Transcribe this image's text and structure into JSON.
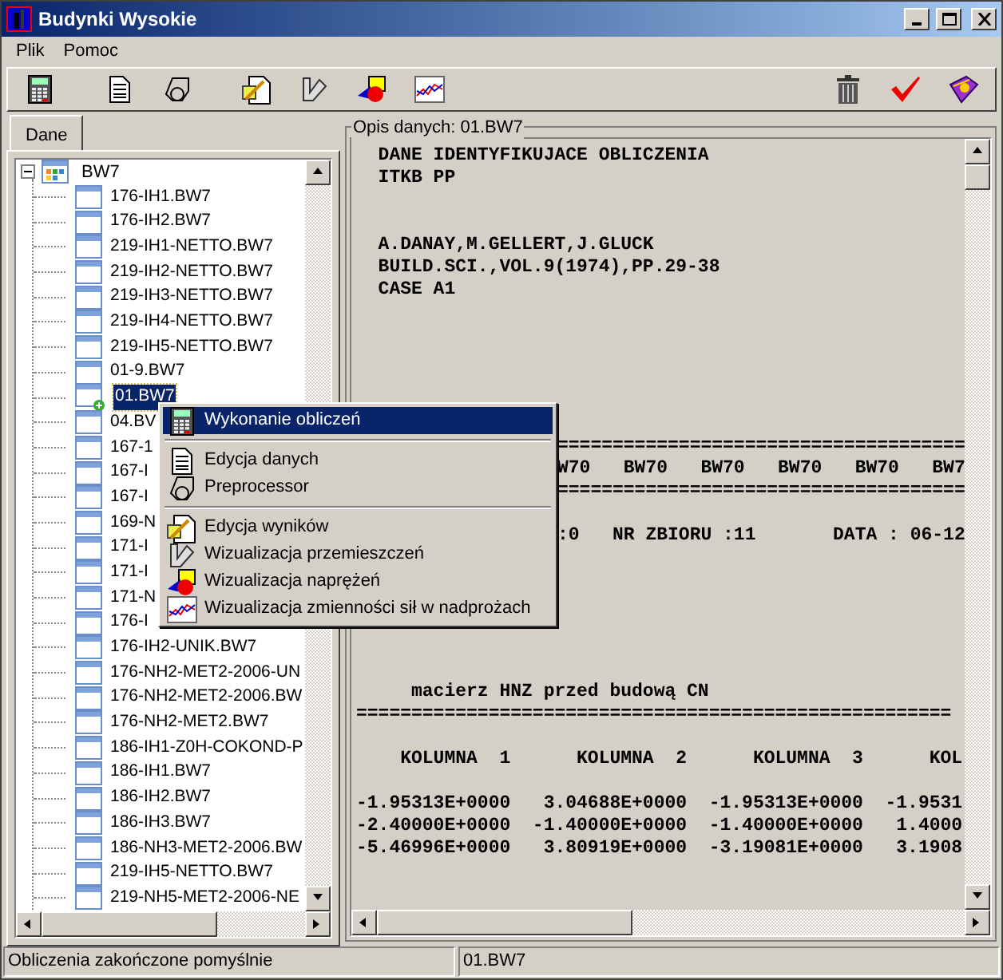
{
  "window": {
    "title": "Budynki Wysokie"
  },
  "menu_bar": [
    "Plik",
    "Pomoc"
  ],
  "tabs": [
    {
      "label": "Dane",
      "selected": true
    }
  ],
  "tree": {
    "label": "BW7",
    "expanded": true,
    "children": [
      {
        "label": "176-IH1.BW7",
        "selected": false
      },
      {
        "label": "176-IH2.BW7",
        "selected": false
      },
      {
        "label": "219-IH1-NETTO.BW7",
        "selected": false
      },
      {
        "label": "219-IH2-NETTO.BW7",
        "selected": false
      },
      {
        "label": "219-IH3-NETTO.BW7",
        "selected": false
      },
      {
        "label": "219-IH4-NETTO.BW7",
        "selected": false
      },
      {
        "label": "219-IH5-NETTO.BW7",
        "selected": false
      },
      {
        "label": "01-9.BW7",
        "selected": false
      },
      {
        "label": "01.BW7",
        "selected": true
      },
      {
        "label": "04.BV",
        "selected": false
      },
      {
        "label": "167-1",
        "selected": false
      },
      {
        "label": "167-I",
        "selected": false
      },
      {
        "label": "167-I",
        "selected": false
      },
      {
        "label": "169-N",
        "selected": false
      },
      {
        "label": "171-I",
        "selected": false
      },
      {
        "label": "171-I",
        "selected": false
      },
      {
        "label": "171-N",
        "selected": false
      },
      {
        "label": "176-I",
        "selected": false
      },
      {
        "label": "176-IH2-UNIK.BW7",
        "selected": false
      },
      {
        "label": "176-NH2-MET2-2006-UN",
        "selected": false
      },
      {
        "label": "176-NH2-MET2-2006.BW",
        "selected": false
      },
      {
        "label": "176-NH2-MET2.BW7",
        "selected": false
      },
      {
        "label": "186-IH1-Z0H-COKOND-P",
        "selected": false
      },
      {
        "label": "186-IH1.BW7",
        "selected": false
      },
      {
        "label": "186-IH2.BW7",
        "selected": false
      },
      {
        "label": "186-IH3.BW7",
        "selected": false
      },
      {
        "label": "186-NH3-MET2-2006.BW",
        "selected": false
      },
      {
        "label": "219-IH5-NETTO.BW7",
        "selected": false
      },
      {
        "label": "219-NH5-MET2-2006-NE",
        "selected": false
      }
    ]
  },
  "description": {
    "title": "Opis danych: 01.BW7",
    "lines": [
      {
        "kind": "full",
        "text": "  DANE IDENTYFIKUJACE OBLICZENIA"
      },
      {
        "kind": "full",
        "text": "  ITKB PP"
      },
      {
        "kind": "blank"
      },
      {
        "kind": "blank"
      },
      {
        "kind": "full",
        "text": "  A.DANAY,M.GELLERT,J.GLUCK"
      },
      {
        "kind": "full",
        "text": "  BUILD.SCI.,VOL.9(1974),PP.29-38"
      },
      {
        "kind": "full",
        "text": "  CASE A1"
      },
      {
        "kind": "blank"
      },
      {
        "kind": "blank"
      },
      {
        "kind": "blank"
      },
      {
        "kind": "blank"
      },
      {
        "kind": "blank"
      },
      {
        "kind": "blank"
      },
      {
        "kind": "behind_menu",
        "text": "====================================="
      },
      {
        "kind": "behind_menu",
        "text": "W70   BW70   BW70   BW70   BW70   BW7"
      },
      {
        "kind": "behind_menu",
        "text": "====================================="
      },
      {
        "kind": "blank"
      },
      {
        "kind": "behind_menu",
        "text": ":0   NR ZBIORU :11       DATA : 06-12"
      },
      {
        "kind": "blank"
      },
      {
        "kind": "blank"
      },
      {
        "kind": "blank"
      },
      {
        "kind": "blank"
      },
      {
        "kind": "blank"
      },
      {
        "kind": "blank"
      },
      {
        "kind": "full",
        "text": "     macierz HNZ przed budową CN"
      },
      {
        "kind": "full",
        "text": "======================================================"
      },
      {
        "kind": "blank"
      },
      {
        "kind": "full",
        "text": "    KOLUMNA  1      KOLUMNA  2      KOLUMNA  3      KOL"
      },
      {
        "kind": "blank"
      },
      {
        "kind": "full",
        "text": "-1.95313E+0000   3.04688E+0000  -1.95313E+0000  -1.9531"
      },
      {
        "kind": "full",
        "text": "-2.40000E+0000  -1.40000E+0000  -1.40000E+0000   1.4000"
      },
      {
        "kind": "full",
        "text": "-5.46996E+0000   3.80919E+0000  -3.19081E+0000   3.1908"
      }
    ]
  },
  "context_menu": [
    {
      "kind": "item",
      "label": "Wykonanie obliczeń",
      "selected": true
    },
    {
      "kind": "separator"
    },
    {
      "kind": "item",
      "label": "Edycja danych",
      "selected": false
    },
    {
      "kind": "item",
      "label": "Preprocessor",
      "selected": false
    },
    {
      "kind": "separator"
    },
    {
      "kind": "item",
      "label": "Edycja wyników",
      "selected": false
    },
    {
      "kind": "item",
      "label": "Wizualizacja przemieszczeń",
      "selected": false
    },
    {
      "kind": "item",
      "label": "Wizualizacja naprężeń",
      "selected": false
    },
    {
      "kind": "item",
      "label": "Wizualizacja zmienności sił w nadprożach",
      "selected": false
    }
  ],
  "status_bar": [
    "Obliczenia zakończone pomyślnie",
    "01.BW7"
  ]
}
